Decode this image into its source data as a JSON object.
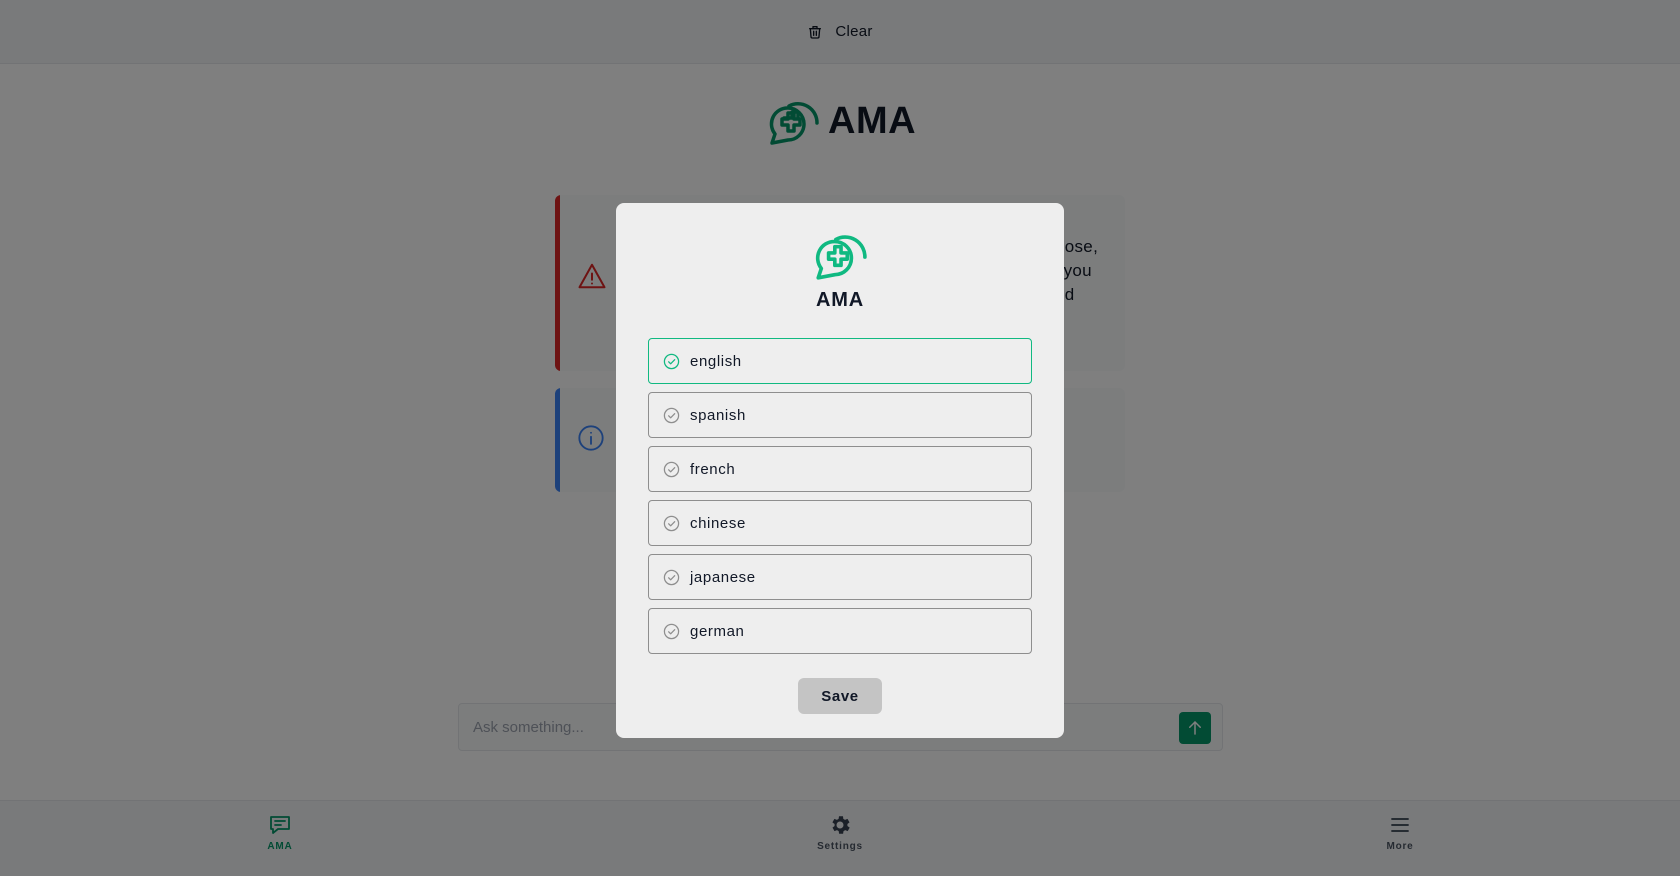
{
  "header": {
    "clear_label": "Clear",
    "clear_icon": "trash-icon"
  },
  "brand": {
    "title": "AMA",
    "icon": "medical-chat-logo"
  },
  "cards": {
    "warning": {
      "icon": "warning-triangle-icon",
      "text_visible": "nose,\n' you\ned"
    },
    "info": {
      "icon": "info-circle-icon"
    }
  },
  "ask": {
    "placeholder": "Ask something...",
    "send_icon": "arrow-up-icon"
  },
  "nav": {
    "ama": {
      "label": "AMA",
      "icon": "chat-icon"
    },
    "settings": {
      "label": "Settings",
      "icon": "gear-icon"
    },
    "more": {
      "label": "More",
      "icon": "menu-icon"
    }
  },
  "modal": {
    "title": "AMA",
    "selected": "english",
    "languages": [
      "english",
      "spanish",
      "french",
      "chinese",
      "japanese",
      "german"
    ],
    "save_label": "Save"
  },
  "colors": {
    "accent": "#10b981",
    "accent_dark": "#059669",
    "danger": "#dc2626",
    "info": "#3b82f6"
  }
}
